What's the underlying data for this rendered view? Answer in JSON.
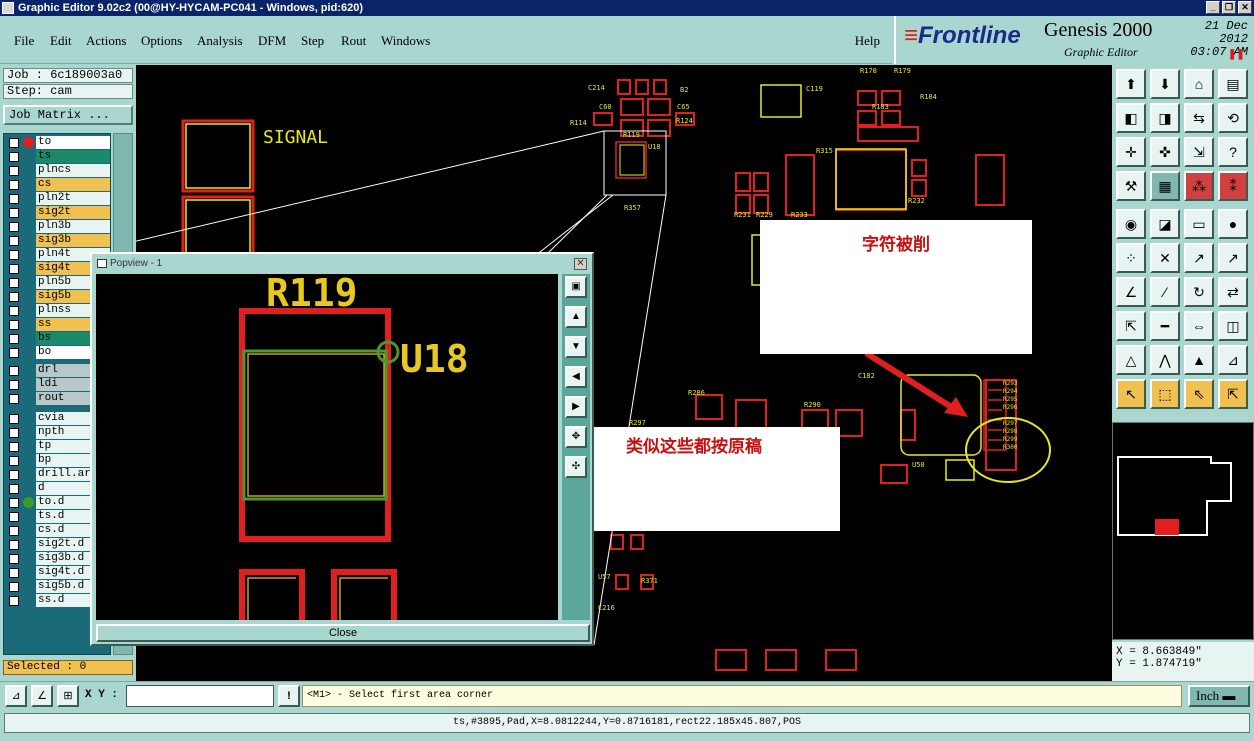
{
  "window": {
    "title": "Graphic Editor 9.02c2 (00@HY-HYCAM-PC041 - Windows, pid:620)",
    "min": "_",
    "max": "❐",
    "close": "✕"
  },
  "menu": {
    "items": [
      "File",
      "Edit",
      "Actions",
      "Options",
      "Analysis",
      "DFM",
      "Step",
      "Rout",
      "Windows"
    ],
    "help": "Help"
  },
  "brand": {
    "logo_bars": "≡",
    "logo": "Frontline",
    "product": "Genesis 2000",
    "subtitle": "Graphic Editor",
    "date": "21 Dec 2012",
    "time": "03:07 AM",
    "pause": "❚❚"
  },
  "job": {
    "job": "Job : 6c189003a0",
    "step": "Step: cam",
    "matrix_button": "Job Matrix ...",
    "selected": "Selected : 0"
  },
  "layers": [
    {
      "name": "to",
      "color": "#ffffff",
      "dot": "#e02020"
    },
    {
      "name": "ts",
      "color": "#1a8a6a",
      "dot": ""
    },
    {
      "name": "plncs",
      "color": "#e8f4f2",
      "dot": ""
    },
    {
      "name": "cs",
      "color": "#f0c050",
      "dot": ""
    },
    {
      "name": "pln2t",
      "color": "#e8f4f2",
      "dot": ""
    },
    {
      "name": "sig2t",
      "color": "#f0c050",
      "dot": ""
    },
    {
      "name": "pln3b",
      "color": "#e8f4f2",
      "dot": ""
    },
    {
      "name": "sig3b",
      "color": "#f0c050",
      "dot": ""
    },
    {
      "name": "pln4t",
      "color": "#e8f4f2",
      "dot": ""
    },
    {
      "name": "sig4t",
      "color": "#f0c050",
      "dot": ""
    },
    {
      "name": "pln5b",
      "color": "#e8f4f2",
      "dot": ""
    },
    {
      "name": "sig5b",
      "color": "#f0c050",
      "dot": ""
    },
    {
      "name": "plnss",
      "color": "#e8f4f2",
      "dot": ""
    },
    {
      "name": "ss",
      "color": "#f0c050",
      "dot": ""
    },
    {
      "name": "bs",
      "color": "#1a8a6a",
      "dot": ""
    },
    {
      "name": "bo",
      "color": "#ffffff",
      "dot": ""
    },
    {
      "name": "drl",
      "color": "#b8c8c8",
      "dot": ""
    },
    {
      "name": "ldi",
      "color": "#b8c8c8",
      "dot": ""
    },
    {
      "name": "rout",
      "color": "#b8c8c8",
      "dot": ""
    },
    {
      "name": "cvia",
      "color": "#e8f4f2",
      "dot": ""
    },
    {
      "name": "npth",
      "color": "#e8f4f2",
      "dot": ""
    },
    {
      "name": "tp",
      "color": "#e8f4f2",
      "dot": ""
    },
    {
      "name": "bp",
      "color": "#e8f4f2",
      "dot": ""
    },
    {
      "name": "drill.art",
      "color": "#e8f4f2",
      "dot": ""
    },
    {
      "name": "d",
      "color": "#e8f4f2",
      "dot": ""
    },
    {
      "name": "to.d",
      "color": "#e8f4f2",
      "dot": "#3a9a2a"
    },
    {
      "name": "ts.d",
      "color": "#e8f4f2",
      "dot": ""
    },
    {
      "name": "cs.d",
      "color": "#e8f4f2",
      "dot": ""
    },
    {
      "name": "sig2t.d",
      "color": "#e8f4f2",
      "dot": ""
    },
    {
      "name": "sig3b.d",
      "color": "#e8f4f2",
      "dot": ""
    },
    {
      "name": "sig4t.d",
      "color": "#e8f4f2",
      "dot": ""
    },
    {
      "name": "sig5b.d",
      "color": "#e8f4f2",
      "dot": ""
    },
    {
      "name": "ss.d",
      "color": "#e8f4f2",
      "dot": ""
    }
  ],
  "canvas": {
    "signal_label": "SIGNAL",
    "refs": [
      "C214",
      "C60",
      "R114",
      "B2",
      "C65",
      "R124",
      "R119",
      "U18",
      "R357",
      "C119",
      "R178",
      "R179",
      "R183",
      "R184",
      "R219",
      "R220",
      "R315",
      "C133",
      "C137",
      "R231",
      "R229",
      "R233",
      "R232",
      "C136",
      "R227",
      "R226",
      "R217",
      "C182",
      "C186",
      "R306",
      "R297",
      "R290",
      "C149",
      "U50",
      "R308",
      "C216",
      "U57",
      "R371",
      "R286",
      "C152"
    ],
    "circled_refs": [
      "R293",
      "R294",
      "R295",
      "R296",
      "R297",
      "R298",
      "R299",
      "R300"
    ]
  },
  "notes": {
    "top": "字符被削",
    "middle": "类似这些都按原稿"
  },
  "popview": {
    "title": "Popview - 1",
    "close_x": "✕",
    "ref1": "R119",
    "ref2": "U18",
    "close_button": "Close"
  },
  "coords": {
    "x": "X = 8.663849\"",
    "y": "Y = 1.874719\""
  },
  "bottom": {
    "xy_label": "X Y :",
    "prompt": "<M1> - Select first area corner",
    "units": "Inch ▬",
    "warn": "!"
  },
  "status": "ts,#3895,Pad,X=8.0812244,Y=0.8716181,rect22.185x45.807,POS",
  "colors": {
    "copper": "#e02020",
    "pad": "#f0c050",
    "outline": "#e8e820",
    "selection": "#ffffff",
    "accent": "#1a2a8a"
  }
}
